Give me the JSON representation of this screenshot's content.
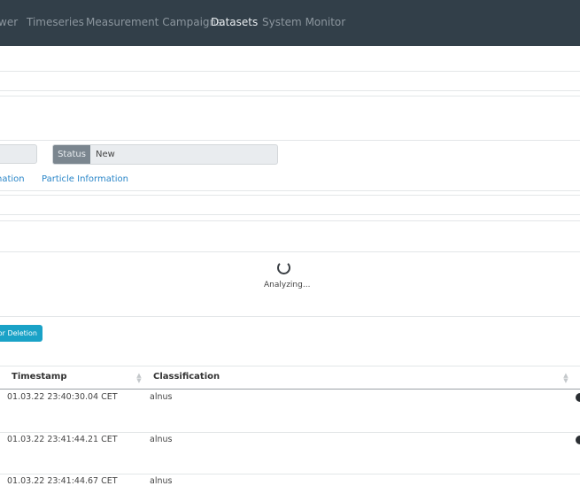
{
  "nav": {
    "items": [
      {
        "label": "wer",
        "active": false
      },
      {
        "label": "Timeseries",
        "active": false
      },
      {
        "label": "Measurement Campaigns",
        "active": false
      },
      {
        "label": "Datasets",
        "active": true
      },
      {
        "label": "System Monitor",
        "active": false
      }
    ]
  },
  "status": {
    "label": "Status",
    "value": "New"
  },
  "tabs": [
    {
      "label": "nation"
    },
    {
      "label": "Particle Information"
    }
  ],
  "analysis": {
    "text": "Analyzing..."
  },
  "delete_button": {
    "label": "or Deletion"
  },
  "table": {
    "columns": [
      {
        "label": "Timestamp"
      },
      {
        "label": "Classification"
      }
    ],
    "rows": [
      {
        "timestamp": "01.03.22 23:40:30.04 CET",
        "classification": "alnus"
      },
      {
        "timestamp": "01.03.22 23:41:44.21 CET",
        "classification": "alnus"
      },
      {
        "timestamp": "01.03.22 23:41:44.67 CET",
        "classification": "alnus"
      }
    ]
  },
  "colors": {
    "navbar": "#323f49",
    "active_nav": "#e9edf0",
    "link": "#2a86c8",
    "button": "#1aa2c7"
  }
}
